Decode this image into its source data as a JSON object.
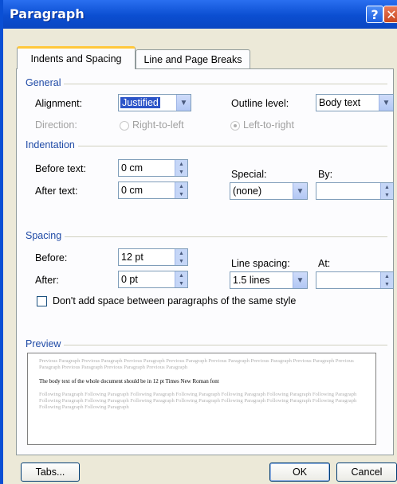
{
  "window": {
    "title": "Paragraph",
    "help_label": "?",
    "close_label": "✕"
  },
  "tabs": [
    {
      "label": "Indents and Spacing",
      "active": true
    },
    {
      "label": "Line and Page Breaks",
      "active": false
    }
  ],
  "general": {
    "heading": "General",
    "alignment_label": "Alignment:",
    "alignment_value": "Justified",
    "outline_label": "Outline level:",
    "outline_value": "Body text",
    "direction_label": "Direction:",
    "rtl_label": "Right-to-left",
    "ltr_label": "Left-to-right"
  },
  "indentation": {
    "heading": "Indentation",
    "before_label": "Before text:",
    "before_value": "0 cm",
    "after_label": "After text:",
    "after_value": "0 cm",
    "special_label": "Special:",
    "special_value": "(none)",
    "by_label": "By:",
    "by_value": ""
  },
  "spacing": {
    "heading": "Spacing",
    "before_label": "Before:",
    "before_value": "12 pt",
    "after_label": "After:",
    "after_value": "0 pt",
    "line_spacing_label": "Line spacing:",
    "line_spacing_value": "1.5 lines",
    "at_label": "At:",
    "at_value": "",
    "dont_add_label": "Don't add space between paragraphs of the same style"
  },
  "preview": {
    "heading": "Preview",
    "previous_text": "Previous Paragraph Previous Paragraph Previous Paragraph Previous Paragraph Previous Paragraph Previous Paragraph Previous Paragraph Previous Paragraph Previous Paragraph Previous Paragraph Previous Paragraph",
    "body_text": "The body text of the whole document should be in 12 pt Times New Roman font",
    "following_text": "Following Paragraph Following Paragraph Following Paragraph Following Paragraph Following Paragraph Following Paragraph Following Paragraph Following Paragraph Following Paragraph Following Paragraph Following Paragraph Following Paragraph Following Paragraph Following Paragraph Following Paragraph Following Paragraph"
  },
  "buttons": {
    "tabs": "Tabs...",
    "ok": "OK",
    "cancel": "Cancel"
  },
  "colors": {
    "titlebar": "#0b4ed1",
    "group_heading": "#1f4aa6",
    "dialog_bg": "#ece9d8",
    "tab_highlight": "#ffc83c"
  }
}
